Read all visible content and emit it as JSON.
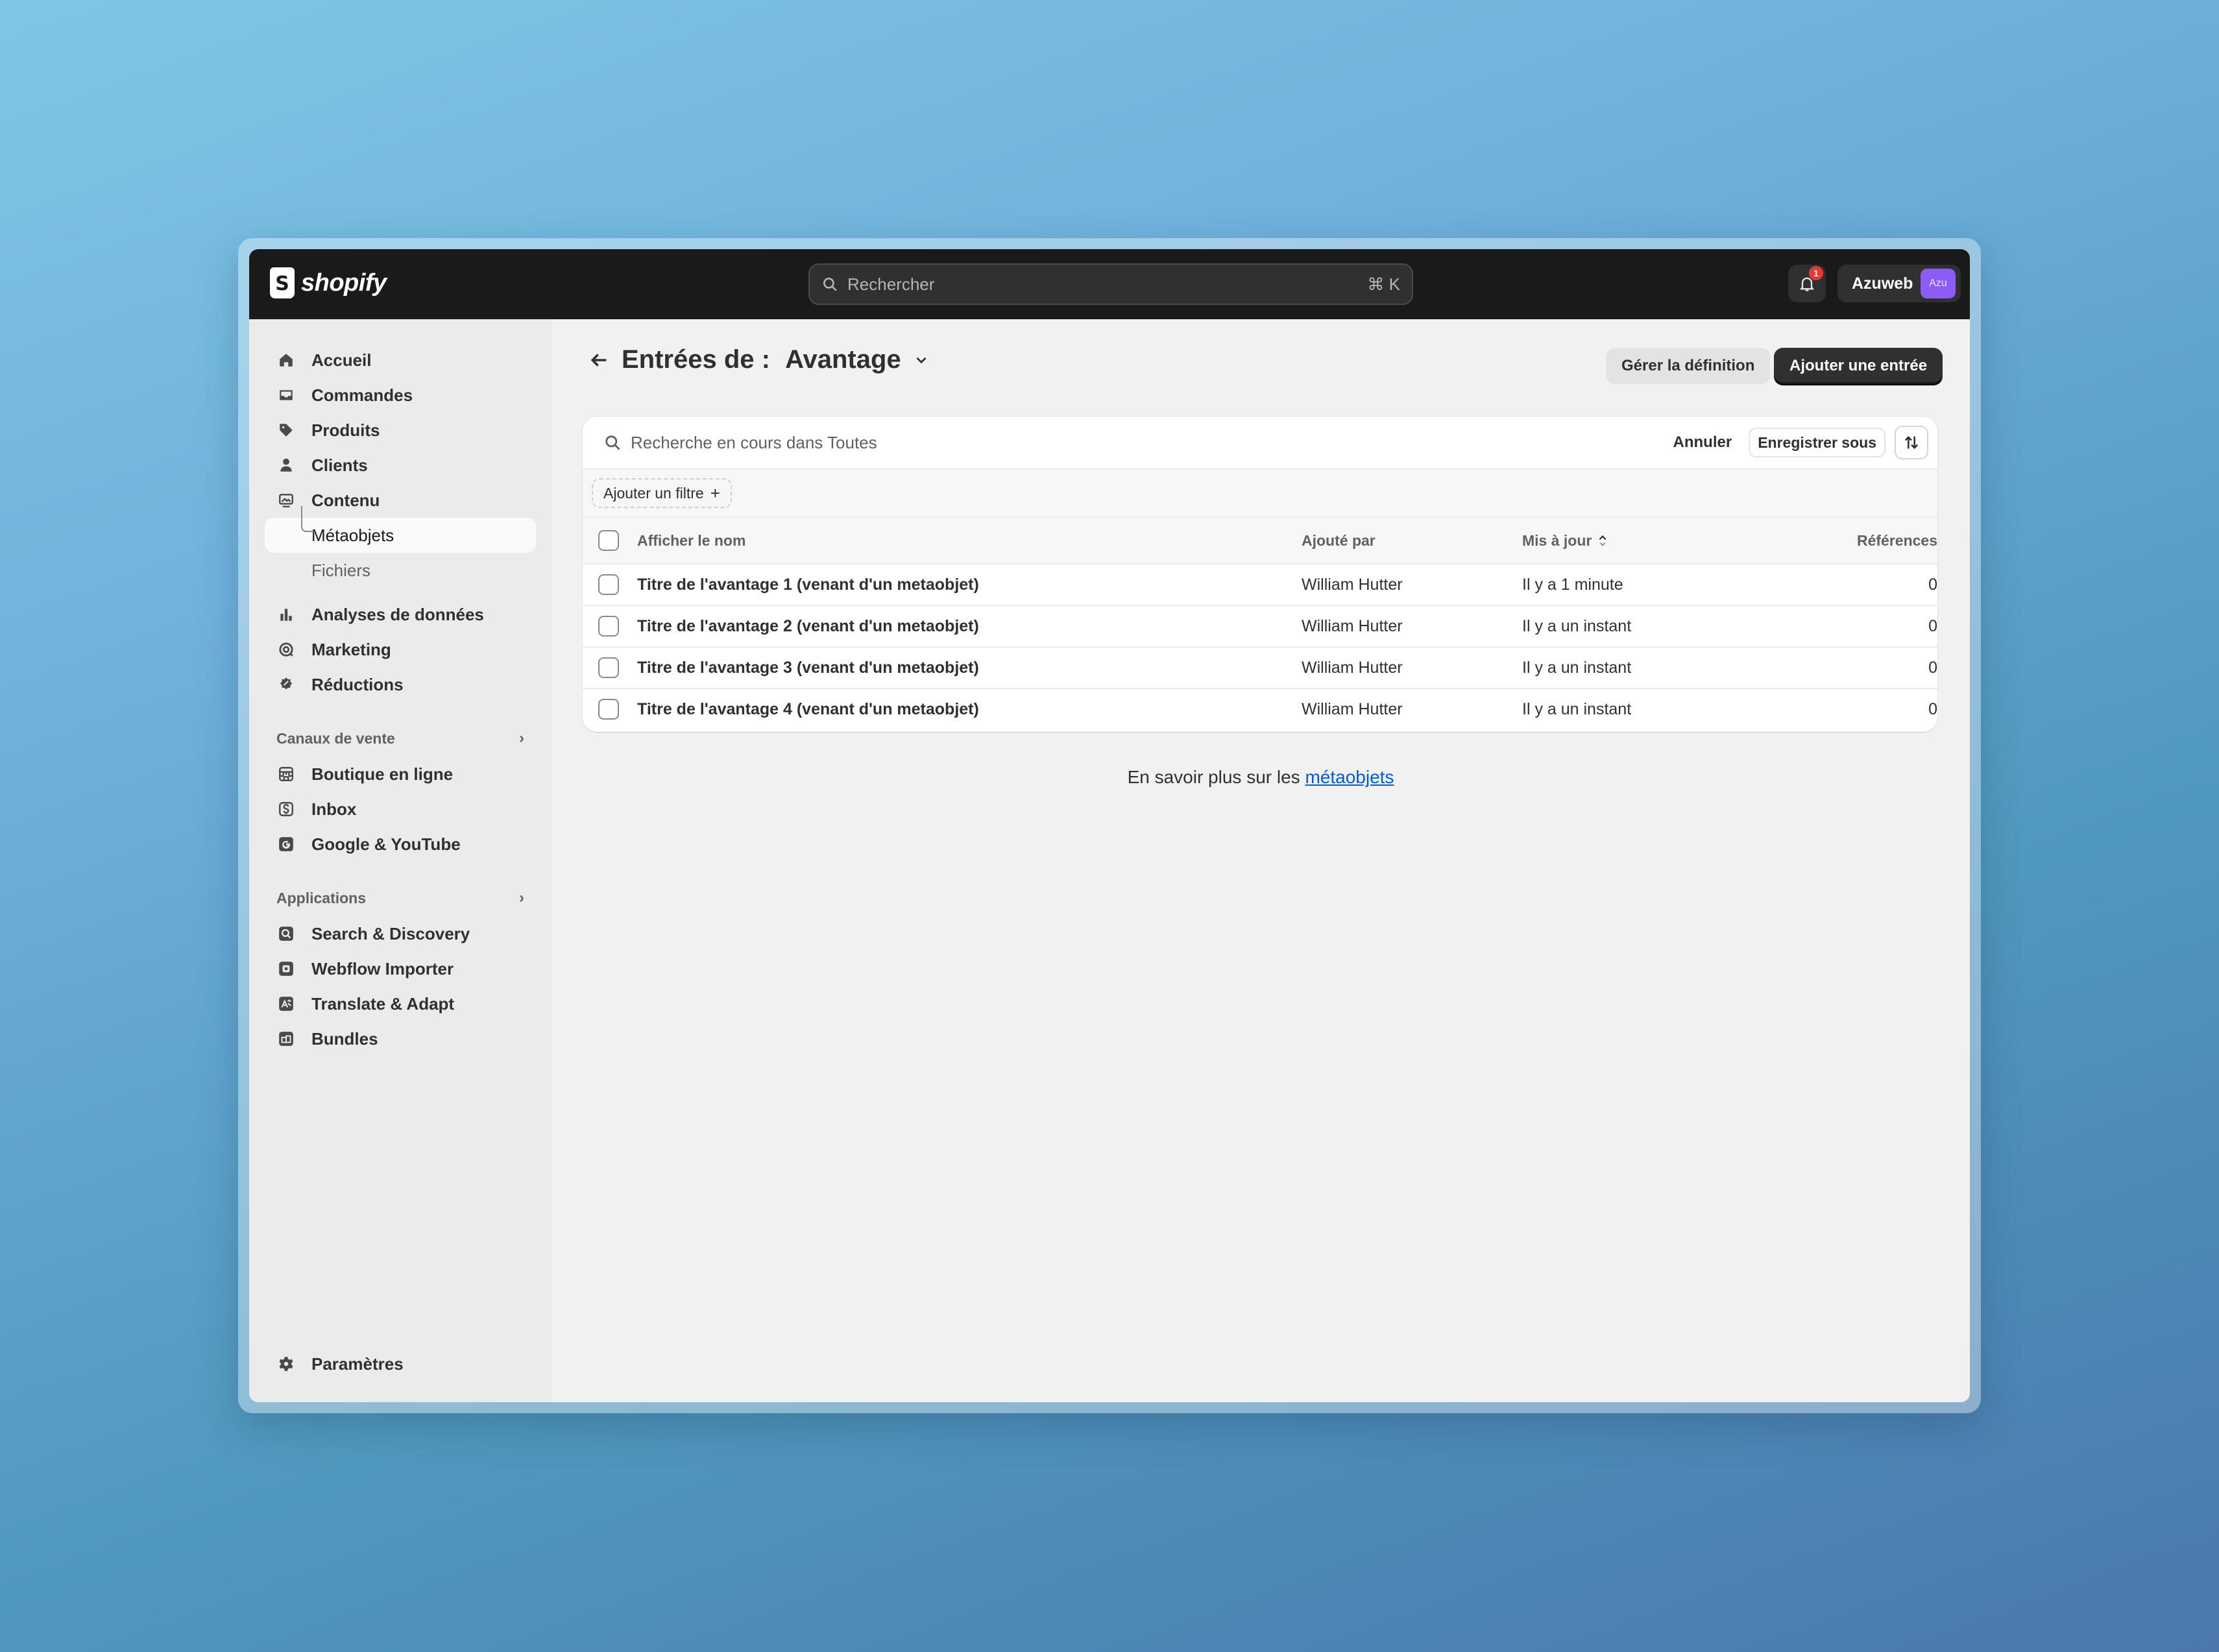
{
  "brand": {
    "name": "shopify"
  },
  "topbar": {
    "search_placeholder": "Rechercher",
    "search_shortcut": "⌘ K",
    "notification_count": "1",
    "account_name": "Azuweb",
    "avatar_text": "Azu"
  },
  "sidebar": {
    "items": [
      {
        "label": "Accueil",
        "icon": "home-icon"
      },
      {
        "label": "Commandes",
        "icon": "inbox-icon"
      },
      {
        "label": "Produits",
        "icon": "tag-icon"
      },
      {
        "label": "Clients",
        "icon": "person-icon"
      },
      {
        "label": "Contenu",
        "icon": "image-icon"
      },
      {
        "label": "Métaobjets",
        "active": true
      },
      {
        "label": "Fichiers"
      },
      {
        "label": "Analyses de données",
        "icon": "bar-chart-icon"
      },
      {
        "label": "Marketing",
        "icon": "target-icon"
      },
      {
        "label": "Réductions",
        "icon": "discount-icon"
      }
    ],
    "sales_channels_title": "Canaux de vente",
    "sales_channels": [
      {
        "label": "Boutique en ligne",
        "icon": "store-icon"
      },
      {
        "label": "Inbox",
        "icon": "chat-icon"
      },
      {
        "label": "Google & YouTube",
        "icon": "google-icon"
      }
    ],
    "apps_title": "Applications",
    "apps": [
      {
        "label": "Search & Discovery",
        "icon": "search-app-icon"
      },
      {
        "label": "Webflow Importer",
        "icon": "importer-app-icon"
      },
      {
        "label": "Translate & Adapt",
        "icon": "translate-app-icon"
      },
      {
        "label": "Bundles",
        "icon": "bundles-app-icon"
      }
    ],
    "settings_label": "Paramètres"
  },
  "page": {
    "title_prefix": "Entrées de :",
    "title_type": "Avantage",
    "manage_button": "Gérer la définition",
    "add_button": "Ajouter une entrée"
  },
  "filters": {
    "search_text": "Recherche en cours dans Toutes",
    "cancel_label": "Annuler",
    "save_as_label": "Enregistrer sous",
    "add_filter_label": "Ajouter un filtre"
  },
  "table": {
    "headers": {
      "name": "Afficher le nom",
      "added_by": "Ajouté par",
      "updated": "Mis à jour",
      "references": "Références"
    },
    "rows": [
      {
        "name": "Titre de l'avantage 1 (venant d'un metaobjet)",
        "added_by": "William Hutter",
        "updated": "Il y a 1 minute",
        "references": "0"
      },
      {
        "name": "Titre de l'avantage 2 (venant d'un metaobjet)",
        "added_by": "William Hutter",
        "updated": "Il y a un instant",
        "references": "0"
      },
      {
        "name": "Titre de l'avantage 3 (venant d'un metaobjet)",
        "added_by": "William Hutter",
        "updated": "Il y a un instant",
        "references": "0"
      },
      {
        "name": "Titre de l'avantage 4 (venant d'un metaobjet)",
        "added_by": "William Hutter",
        "updated": "Il y a un instant",
        "references": "0"
      }
    ]
  },
  "footer": {
    "learn_prefix": "En savoir plus sur les",
    "learn_link": "métaobjets"
  },
  "colors": {
    "topbar": "#1a1a1a",
    "primary_button": "#303030",
    "link": "#005bd3",
    "notification": "#e53935",
    "avatar": "#8b5cf6"
  }
}
